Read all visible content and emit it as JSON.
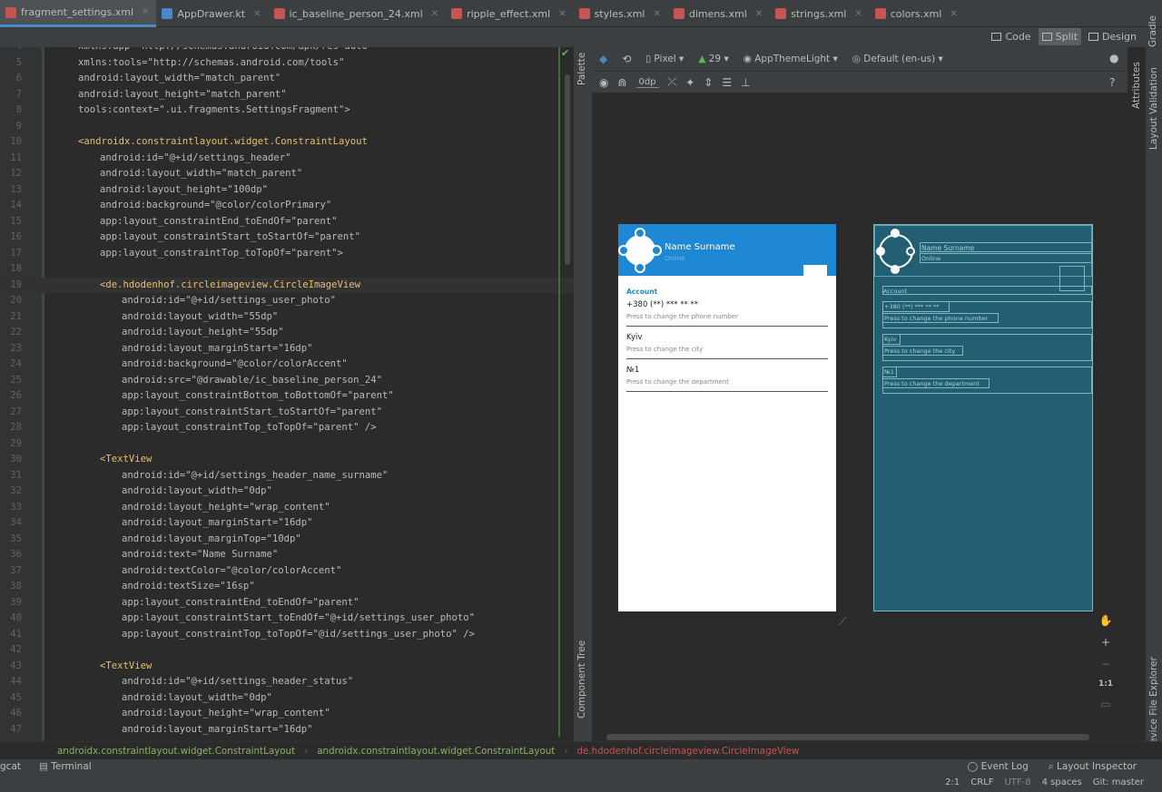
{
  "tabs": [
    {
      "label": "fragment_settings.xml",
      "icon_color": "#c75450",
      "active": true
    },
    {
      "label": "AppDrawer.kt",
      "icon_color": "#4a88c7",
      "active": false
    },
    {
      "label": "ic_baseline_person_24.xml",
      "icon_color": "#c75450",
      "active": false
    },
    {
      "label": "ripple_effect.xml",
      "icon_color": "#c75450",
      "active": false
    },
    {
      "label": "styles.xml",
      "icon_color": "#c75450",
      "active": false
    },
    {
      "label": "dimens.xml",
      "icon_color": "#c75450",
      "active": false
    },
    {
      "label": "strings.xml",
      "icon_color": "#c75450",
      "active": false
    },
    {
      "label": "colors.xml",
      "icon_color": "#c75450",
      "active": false
    }
  ],
  "view_modes": {
    "code": "Code",
    "split": "Split",
    "design": "Design"
  },
  "code_lines": [
    {
      "n": "4",
      "indent": 0,
      "text": "xmlns:app=\"http://schemas.android.com/apk/res-auto\""
    },
    {
      "n": "5",
      "indent": 0,
      "text": "xmlns:tools=\"http://schemas.android.com/tools\""
    },
    {
      "n": "6",
      "indent": 0,
      "text": "android:layout_width=\"match_parent\""
    },
    {
      "n": "7",
      "indent": 0,
      "text": "android:layout_height=\"match_parent\""
    },
    {
      "n": "8",
      "indent": 0,
      "text": "tools:context=\".ui.fragments.SettingsFragment\">"
    },
    {
      "n": "9",
      "indent": 0,
      "text": ""
    },
    {
      "n": "10",
      "indent": 0,
      "text": "<androidx.constraintlayout.widget.ConstraintLayout"
    },
    {
      "n": "11",
      "indent": 1,
      "text": "android:id=\"@+id/settings_header\""
    },
    {
      "n": "12",
      "indent": 1,
      "text": "android:layout_width=\"match_parent\""
    },
    {
      "n": "13",
      "indent": 1,
      "text": "android:layout_height=\"100dp\""
    },
    {
      "n": "14",
      "indent": 1,
      "text": "android:background=\"@color/colorPrimary\""
    },
    {
      "n": "15",
      "indent": 1,
      "text": "app:layout_constraintEnd_toEndOf=\"parent\""
    },
    {
      "n": "16",
      "indent": 1,
      "text": "app:layout_constraintStart_toStartOf=\"parent\""
    },
    {
      "n": "17",
      "indent": 1,
      "text": "app:layout_constraintTop_toTopOf=\"parent\">"
    },
    {
      "n": "18",
      "indent": 0,
      "text": ""
    },
    {
      "n": "19",
      "indent": 1,
      "text": "<de.hdodenhof.circleimageview.CircleImageView"
    },
    {
      "n": "20",
      "indent": 2,
      "text": "android:id=\"@+id/settings_user_photo\""
    },
    {
      "n": "21",
      "indent": 2,
      "text": "android:layout_width=\"55dp\""
    },
    {
      "n": "22",
      "indent": 2,
      "text": "android:layout_height=\"55dp\""
    },
    {
      "n": "23",
      "indent": 2,
      "text": "android:layout_marginStart=\"16dp\""
    },
    {
      "n": "24",
      "indent": 2,
      "text": "android:background=\"@color/colorAccent\""
    },
    {
      "n": "25",
      "indent": 2,
      "text": "android:src=\"@drawable/ic_baseline_person_24\""
    },
    {
      "n": "26",
      "indent": 2,
      "text": "app:layout_constraintBottom_toBottomOf=\"parent\""
    },
    {
      "n": "27",
      "indent": 2,
      "text": "app:layout_constraintStart_toStartOf=\"parent\""
    },
    {
      "n": "28",
      "indent": 2,
      "text": "app:layout_constraintTop_toTopOf=\"parent\" />"
    },
    {
      "n": "29",
      "indent": 0,
      "text": ""
    },
    {
      "n": "30",
      "indent": 1,
      "text": "<TextView"
    },
    {
      "n": "31",
      "indent": 2,
      "text": "android:id=\"@+id/settings_header_name_surname\""
    },
    {
      "n": "32",
      "indent": 2,
      "text": "android:layout_width=\"0dp\""
    },
    {
      "n": "33",
      "indent": 2,
      "text": "android:layout_height=\"wrap_content\""
    },
    {
      "n": "34",
      "indent": 2,
      "text": "android:layout_marginStart=\"16dp\""
    },
    {
      "n": "35",
      "indent": 2,
      "text": "android:layout_marginTop=\"10dp\""
    },
    {
      "n": "36",
      "indent": 2,
      "text": "android:text=\"Name Surname\""
    },
    {
      "n": "37",
      "indent": 2,
      "text": "android:textColor=\"@color/colorAccent\""
    },
    {
      "n": "38",
      "indent": 2,
      "text": "android:textSize=\"16sp\""
    },
    {
      "n": "39",
      "indent": 2,
      "text": "app:layout_constraintEnd_toEndOf=\"parent\""
    },
    {
      "n": "40",
      "indent": 2,
      "text": "app:layout_constraintStart_toEndOf=\"@+id/settings_user_photo\""
    },
    {
      "n": "41",
      "indent": 2,
      "text": "app:layout_constraintTop_toTopOf=\"@id/settings_user_photo\" />"
    },
    {
      "n": "42",
      "indent": 0,
      "text": ""
    },
    {
      "n": "43",
      "indent": 1,
      "text": "<TextView"
    },
    {
      "n": "44",
      "indent": 2,
      "text": "android:id=\"@+id/settings_header_status\""
    },
    {
      "n": "45",
      "indent": 2,
      "text": "android:layout_width=\"0dp\""
    },
    {
      "n": "46",
      "indent": 2,
      "text": "android:layout_height=\"wrap_content\""
    },
    {
      "n": "47",
      "indent": 2,
      "text": "android:layout_marginStart=\"16dp\""
    }
  ],
  "sidebar_left": {
    "palette": "Palette",
    "component_tree": "Component Tree"
  },
  "sidebar_right": {
    "gradle": "Gradle",
    "attributes": "Attributes",
    "layout_validation": "Layout Validation",
    "device_file_explorer": "Device File Explorer"
  },
  "design_toolbar": {
    "device": "Pixel",
    "api": "29",
    "theme": "AppThemeLight",
    "locale": "Default (en-us)",
    "margin": "0dp"
  },
  "preview": {
    "name": "Name Surname",
    "status": "Online",
    "section": "Account",
    "items": [
      {
        "title": "+380 (**) *** ** **",
        "subtitle": "Press to change the phone number"
      },
      {
        "title": "Kyiv",
        "subtitle": "Press to change the city"
      },
      {
        "title": "№1",
        "subtitle": "Press to change the department"
      }
    ]
  },
  "blueprint": {
    "name": "Name Surname",
    "status": "Online",
    "section": "Account",
    "items": [
      {
        "title": "+380 (**) *** ** **",
        "subtitle": "Press to change the phone number"
      },
      {
        "title": "Kyiv",
        "subtitle": "Press to change the city"
      },
      {
        "title": "№1",
        "subtitle": "Press to change the department"
      }
    ]
  },
  "zoom": {
    "plus": "+",
    "minus": "−",
    "ratio": "1:1"
  },
  "breadcrumb": [
    "androidx.constraintlayout.widget.ConstraintLayout",
    "androidx.constraintlayout.widget.ConstraintLayout",
    "de.hdodenhof.circleimageview.CircleImageView"
  ],
  "statusbar": {
    "logcat": "gcat",
    "terminal": "Terminal",
    "event_log": "Event Log",
    "layout_inspector": "Layout Inspector",
    "position": "2:1",
    "line_sep": "CRLF",
    "encoding": "UTF-8",
    "indent": "4 spaces",
    "git": "Git: master"
  },
  "colors": {
    "accent": "#4a88c7",
    "primary": "#1e88d4",
    "blueprint": "#235f72"
  }
}
